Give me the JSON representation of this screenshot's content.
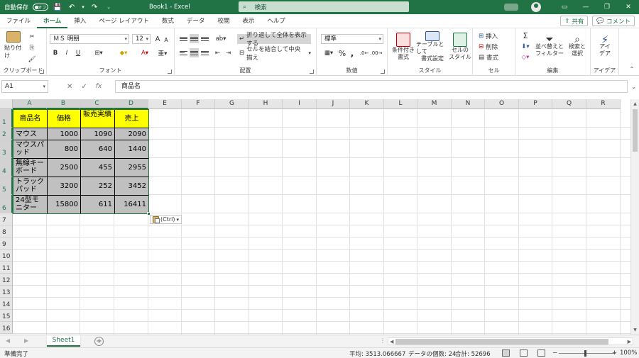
{
  "titlebar": {
    "autosave_label": "自動保存",
    "autosave_state": "オフ",
    "title": "Book1 - Excel",
    "search_placeholder": "検索",
    "accent": "#217346"
  },
  "tabs": [
    "ファイル",
    "ホーム",
    "挿入",
    "ページ レイアウト",
    "数式",
    "データ",
    "校閲",
    "表示",
    "ヘルプ"
  ],
  "active_tab": "ホーム",
  "share_label": "共有",
  "comment_label": "コメント",
  "ribbon": {
    "clipboard": {
      "label": "クリップボード",
      "paste": "貼り付け"
    },
    "font": {
      "label": "フォント",
      "font_name": "ＭＳ 明朝",
      "font_size": "12",
      "bold": "B",
      "italic": "I",
      "underline": "U",
      "grow": "A",
      "shrink": "A"
    },
    "alignment": {
      "label": "配置",
      "wrap": "折り返して全体を表示する",
      "merge": "セルを結合して中央揃え"
    },
    "number": {
      "label": "数値",
      "format": "標準",
      "percent": "%",
      "comma": ","
    },
    "styles": {
      "label": "スタイル",
      "cond": [
        "条件付き",
        "書式"
      ],
      "table": [
        "テーブルとして",
        "書式設定"
      ],
      "cell": [
        "セルの",
        "スタイル"
      ]
    },
    "cells": {
      "label": "セル",
      "insert": "挿入",
      "delete": "削除",
      "format": "書式"
    },
    "editing": {
      "label": "編集",
      "sigma": "Σ",
      "sort": [
        "並べ替えと",
        "フィルター"
      ],
      "find": [
        "検索と",
        "選択"
      ]
    },
    "ideas": {
      "label": "アイデア",
      "btn": [
        "アイ",
        "デア"
      ]
    }
  },
  "formula_bar": {
    "name_box": "A1",
    "fx": "fx",
    "value": "商品名"
  },
  "columns": [
    "A",
    "B",
    "C",
    "D",
    "E",
    "F",
    "G",
    "H",
    "I",
    "J",
    "K",
    "L",
    "M",
    "N",
    "O",
    "P",
    "Q",
    "R"
  ],
  "rows": [
    "1",
    "2",
    "3",
    "4",
    "5",
    "6",
    "7",
    "8",
    "9",
    "10",
    "11",
    "12",
    "13",
    "14",
    "15",
    "16"
  ],
  "table": {
    "headers": [
      "商品名",
      "価格",
      "販売実績",
      "売上"
    ],
    "rows": [
      [
        "マウス",
        "1000",
        "1090",
        "2090"
      ],
      [
        "マウスパッド",
        "800",
        "640",
        "1440"
      ],
      [
        "無線キーボード",
        "2500",
        "455",
        "2955"
      ],
      [
        "トラックパッド",
        "3200",
        "252",
        "3452"
      ],
      [
        "24型モニター",
        "15800",
        "611",
        "16411"
      ]
    ]
  },
  "paste_options": "(Ctrl)",
  "sheet_tab": "Sheet1",
  "status": {
    "ready": "準備完了",
    "average": "平均: 3513.066667",
    "count": "データの個数: 24",
    "sum": "合計: 52696",
    "zoom": "100%"
  }
}
